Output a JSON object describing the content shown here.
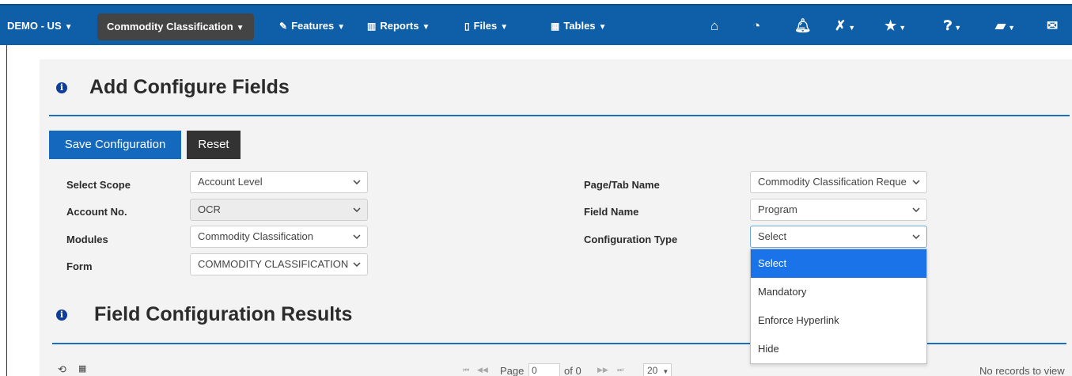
{
  "nav": {
    "account": "DEMO - US",
    "module": "Commodity Classification",
    "features": "Features",
    "reports": "Reports",
    "files": "Files",
    "tables": "Tables"
  },
  "form": {
    "title": "Add Configure Fields",
    "save_label": "Save Configuration",
    "reset_label": "Reset",
    "scope_label": "Select Scope",
    "scope_value": "Account Level",
    "account_label": "Account No.",
    "account_value": "OCR",
    "modules_label": "Modules",
    "modules_value": "Commodity Classification",
    "form_label": "Form",
    "form_value": "COMMODITY CLASSIFICATION",
    "page_label": "Page/Tab Name",
    "page_value": "Commodity Classification Reque",
    "field_label": "Field Name",
    "field_value": "Program",
    "config_label": "Configuration Type",
    "config_value": "Select"
  },
  "config_options": [
    "Select",
    "Mandatory",
    "Enforce Hyperlink",
    "Hide"
  ],
  "results": {
    "title": "Field Configuration Results",
    "page_label": "Page",
    "page_value": "0",
    "of_label": "of 0",
    "rows_value": "20",
    "empty_text": "No records to view"
  },
  "colors": {
    "nav_bg": "#0f5fa8",
    "primary": "#1469be",
    "selected_option": "#1a73e8"
  }
}
